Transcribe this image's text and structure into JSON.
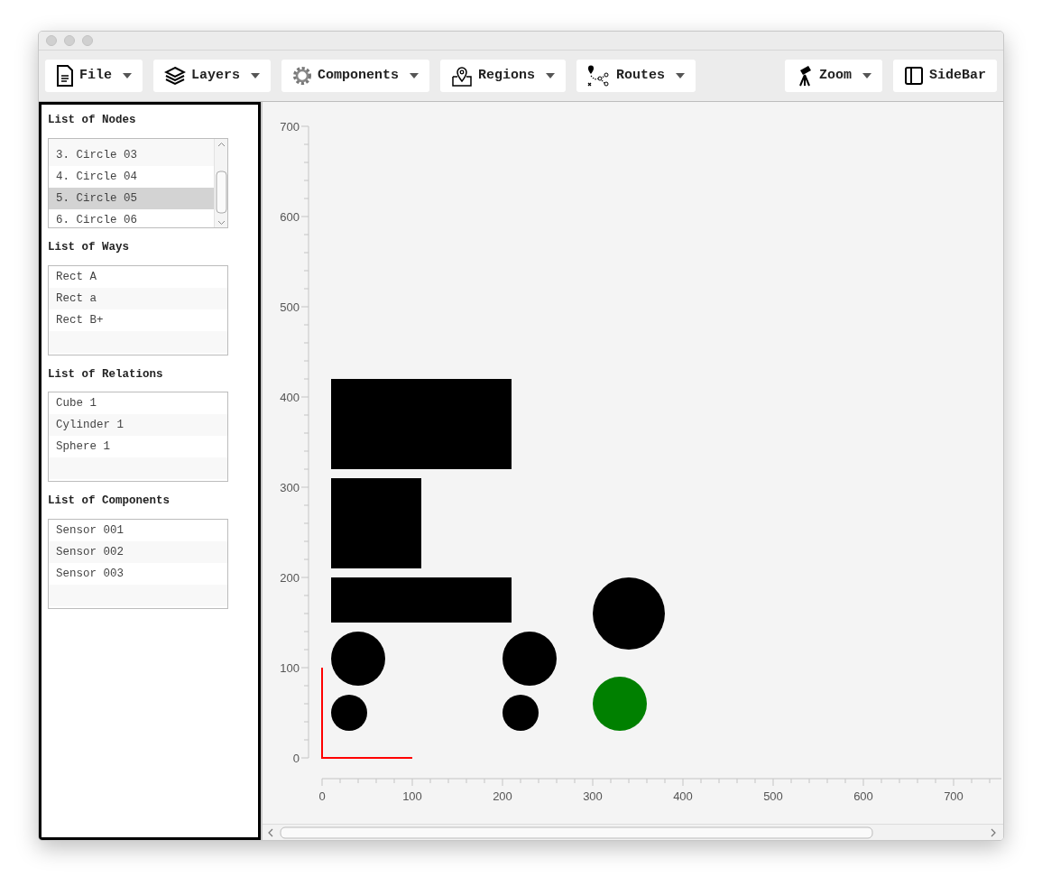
{
  "toolbar": [
    {
      "label": "File",
      "dropdown": true
    },
    {
      "label": "Layers",
      "dropdown": true
    },
    {
      "label": "Components",
      "dropdown": true
    },
    {
      "label": "Regions",
      "dropdown": true
    },
    {
      "label": "Routes",
      "dropdown": true
    },
    {
      "label": "Zoom",
      "dropdown": true
    },
    {
      "label": "SideBar",
      "dropdown": false
    }
  ],
  "sidebar": {
    "sections": [
      {
        "title": "List of Nodes",
        "scrollable": true,
        "items": [
          {
            "label": "3. Circle 03",
            "selected": false
          },
          {
            "label": "4. Circle 04",
            "selected": false
          },
          {
            "label": "5. Circle 05",
            "selected": true
          },
          {
            "label": "6. Circle 06",
            "selected": false
          }
        ]
      },
      {
        "title": "List of Ways",
        "scrollable": false,
        "items": [
          {
            "label": "Rect A",
            "selected": false
          },
          {
            "label": "Rect a",
            "selected": false
          },
          {
            "label": "Rect B+",
            "selected": false
          }
        ]
      },
      {
        "title": "List of Relations",
        "scrollable": false,
        "items": [
          {
            "label": "Cube 1",
            "selected": false
          },
          {
            "label": "Cylinder 1",
            "selected": false
          },
          {
            "label": "Sphere 1",
            "selected": false
          }
        ]
      },
      {
        "title": "List of Components",
        "scrollable": false,
        "items": [
          {
            "label": "Sensor 001",
            "selected": false
          },
          {
            "label": "Sensor 002",
            "selected": false
          },
          {
            "label": "Sensor 003",
            "selected": false
          }
        ]
      }
    ]
  },
  "canvas": {
    "x_axis_labels": [
      "0",
      "100",
      "200",
      "300",
      "400",
      "500",
      "600",
      "700"
    ],
    "y_axis_labels": [
      "700",
      "600",
      "500",
      "400",
      "300",
      "200",
      "100",
      "0"
    ]
  }
}
